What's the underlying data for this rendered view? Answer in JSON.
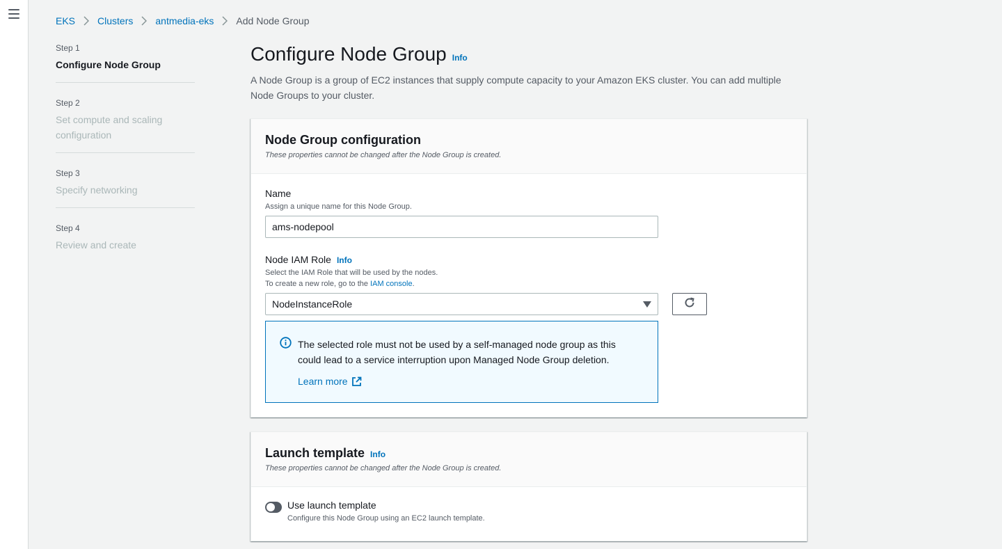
{
  "breadcrumb": {
    "items": [
      "EKS",
      "Clusters",
      "antmedia-eks"
    ],
    "current": "Add Node Group"
  },
  "steps": [
    {
      "num": "Step 1",
      "title": "Configure Node Group",
      "active": true
    },
    {
      "num": "Step 2",
      "title": "Set compute and scaling configuration",
      "active": false
    },
    {
      "num": "Step 3",
      "title": "Specify networking",
      "active": false
    },
    {
      "num": "Step 4",
      "title": "Review and create",
      "active": false
    }
  ],
  "page": {
    "title": "Configure Node Group",
    "info": "Info",
    "description": "A Node Group is a group of EC2 instances that supply compute capacity to your Amazon EKS cluster. You can add multiple Node Groups to your cluster."
  },
  "node_group_config": {
    "title": "Node Group configuration",
    "subtitle": "These properties cannot be changed after the Node Group is created.",
    "name_label": "Name",
    "name_desc": "Assign a unique name for this Node Group.",
    "name_value": "ams-nodepool",
    "role_label": "Node IAM Role",
    "role_info": "Info",
    "role_desc1": "Select the IAM Role that will be used by the nodes.",
    "role_desc2_prefix": "To create a new role, go to the ",
    "role_desc2_link": "IAM console",
    "role_desc2_suffix": ".",
    "role_value": "NodeInstanceRole",
    "alert_text": "The selected role must not be used by a self-managed node group as this could lead to a service interruption upon Managed Node Group deletion.",
    "alert_link": "Learn more"
  },
  "launch_template": {
    "title": "Launch template",
    "info": "Info",
    "subtitle": "These properties cannot be changed after the Node Group is created.",
    "toggle_label": "Use launch template",
    "toggle_desc": "Configure this Node Group using an EC2 launch template.",
    "enabled": false
  },
  "colors": {
    "link": "#0073bb",
    "background": "#f2f3f3",
    "alert_bg": "#f1faff",
    "text": "#16191f",
    "muted": "#545b64"
  }
}
